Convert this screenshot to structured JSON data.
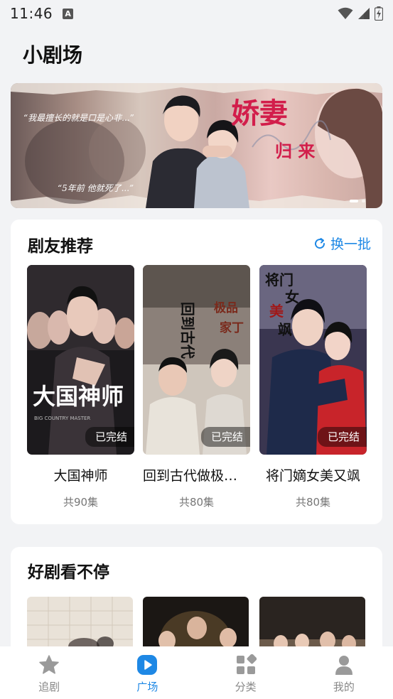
{
  "status_bar": {
    "time": "11:46",
    "notification_badge": "A"
  },
  "page": {
    "title": "小剧场"
  },
  "banner": {
    "quote_1": "“我最擅长的就是口是心非...”",
    "quote_2": "“5年前 他就死了...”",
    "title_main": "娇妻",
    "title_sub": "归 来",
    "active_dot": 1,
    "dot_count": 2
  },
  "recommend": {
    "title": "剧友推荐",
    "refresh_label": "换一批",
    "items": [
      {
        "name": "大国神师",
        "episodes": "共90集",
        "status": "已完结",
        "poster_text": "大国神师"
      },
      {
        "name": "回到古代做极品家丁",
        "episodes": "共80集",
        "status": "已完结",
        "poster_text": "回到古代做极品家丁"
      },
      {
        "name": "将门嫡女美又飒",
        "episodes": "共80集",
        "status": "已完结",
        "poster_text": "将门嫡女美又飒"
      }
    ]
  },
  "good": {
    "title": "好剧看不停"
  },
  "tabbar": {
    "tabs": [
      {
        "label": "追剧",
        "icon": "star-icon",
        "active": false
      },
      {
        "label": "广场",
        "icon": "play-icon",
        "active": true
      },
      {
        "label": "分类",
        "icon": "category-icon",
        "active": false
      },
      {
        "label": "我的",
        "icon": "profile-icon",
        "active": false
      }
    ]
  },
  "colors": {
    "accent": "#1e88e5",
    "banner_title": "#d21e4b"
  }
}
